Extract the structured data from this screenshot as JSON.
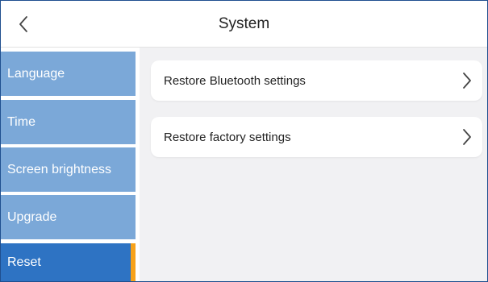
{
  "header": {
    "title": "System",
    "back_icon": "chevron-left-icon"
  },
  "sidebar": {
    "items": [
      {
        "label": "Language",
        "active": false
      },
      {
        "label": "Time",
        "active": false
      },
      {
        "label": "Screen brightness",
        "active": false
      },
      {
        "label": "Upgrade",
        "active": false
      },
      {
        "label": "Reset",
        "active": true
      }
    ]
  },
  "main": {
    "options": [
      {
        "label": "Restore Bluetooth settings",
        "icon": "chevron-right-icon"
      },
      {
        "label": "Restore factory settings",
        "icon": "chevron-right-icon"
      }
    ]
  },
  "colors": {
    "sidebar_item": "#7ba8d8",
    "sidebar_active": "#2e73c3",
    "active_marker": "#f7a21b",
    "background": "#f1f1f3"
  }
}
